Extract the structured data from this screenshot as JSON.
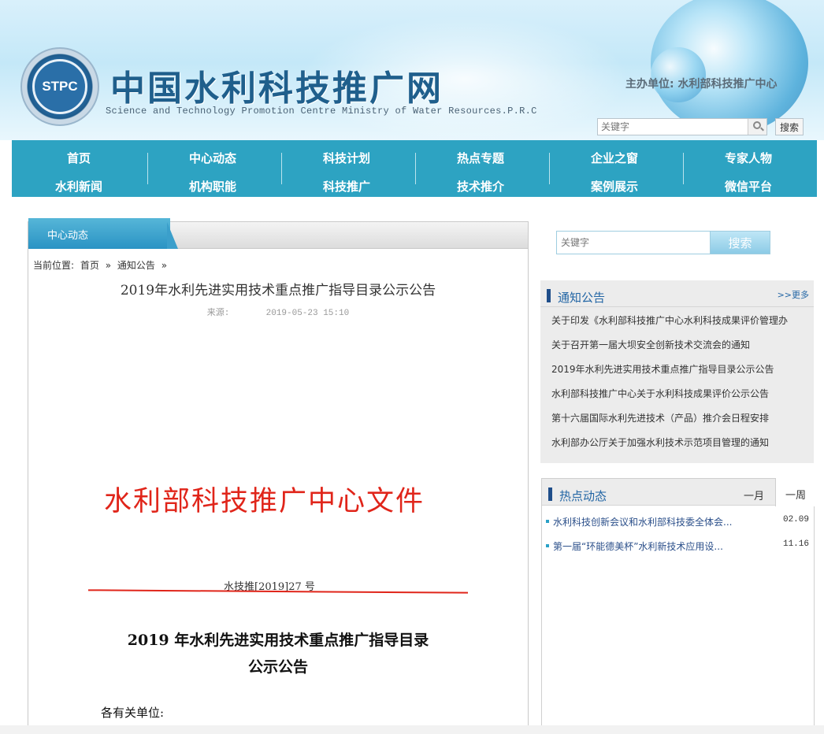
{
  "header": {
    "logo_text": "STPC",
    "title": "中国水利科技推广网",
    "subtitle": "Science and Technology Promotion Centre Ministry of Water Resources.P.R.C",
    "sponsor_label": "主办单位:",
    "sponsor_name": "水利部科技推广中心",
    "search_placeholder": "关键字",
    "search_button": "搜索"
  },
  "nav": {
    "items": [
      [
        "首页",
        "水利新闻"
      ],
      [
        "中心动态",
        "机构职能"
      ],
      [
        "科技计划",
        "科技推广"
      ],
      [
        "热点专题",
        "技术推介"
      ],
      [
        "企业之窗",
        "案例展示"
      ],
      [
        "专家人物",
        "微信平台"
      ]
    ]
  },
  "main": {
    "tab": "中心动态",
    "breadcrumb": {
      "label": "当前位置:",
      "home": "首页",
      "sep1": "»",
      "section": "通知公告",
      "sep2": "»"
    },
    "title": "2019年水利先进实用技术重点推广指导目录公示公告",
    "source_label": "来源:",
    "datetime": "2019-05-23 15:10",
    "doc_head": "水利部科技推广中心文件",
    "doc_number": "水技推[2019]27 号",
    "doc_title_line1": "2019 年水利先进实用技术重点推广指导目录",
    "doc_title_line2": "公示公告",
    "salutation": "各有关单位:"
  },
  "sidebar": {
    "search_placeholder": "关键字",
    "search_button": "搜索",
    "notice": {
      "title": "通知公告",
      "more": ">>更多",
      "items": [
        "关于印发《水利部科技推广中心水利科技成果评价管理办",
        "关于召开第一届大坝安全创新技术交流会的通知",
        "2019年水利先进实用技术重点推广指导目录公示公告",
        "水利部科技推广中心关于水利科技成果评价公示公告",
        "第十六届国际水利先进技术（产品）推介会日程安排",
        "水利部办公厅关于加强水利技术示范项目管理的通知"
      ]
    },
    "hot": {
      "title": "热点动态",
      "tab_month": "一月",
      "tab_week": "一周",
      "items": [
        {
          "text": "水利科技创新会议和水利部科技委全体会...",
          "date": "02.09"
        },
        {
          "text": "第一届“环能德美杯”水利新技术应用设...",
          "date": "11.16"
        }
      ]
    }
  },
  "colors": {
    "nav_bg": "#2da3c2",
    "accent_blue": "#2366a5",
    "doc_red": "#e0251a"
  }
}
